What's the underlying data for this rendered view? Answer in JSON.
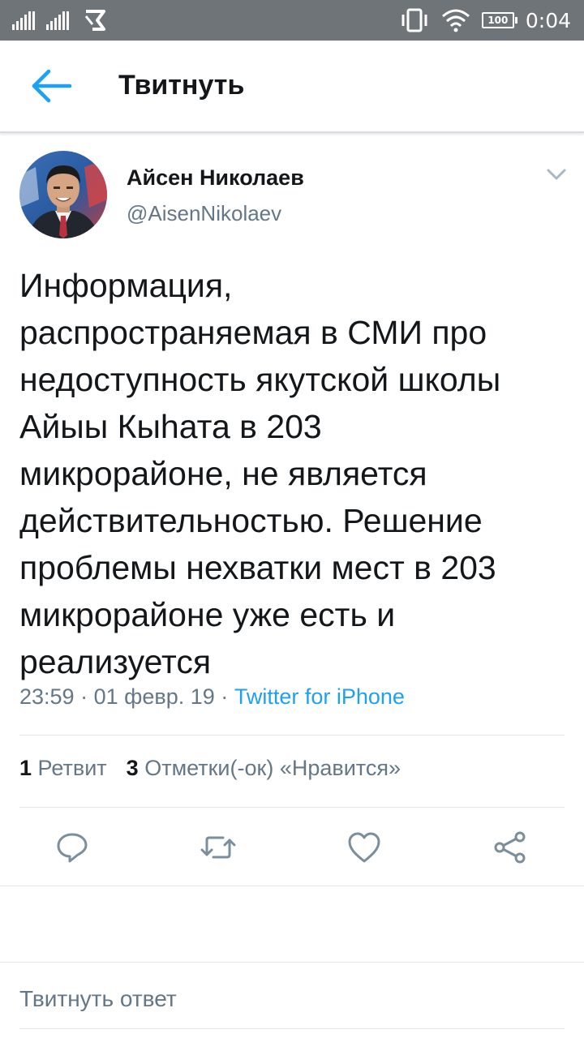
{
  "status_bar": {
    "time": "0:04",
    "battery": "100",
    "icons": [
      "signal-icon",
      "signal-icon",
      "data-saver-icon",
      "vibrate-icon",
      "wifi-icon",
      "battery-icon"
    ]
  },
  "header": {
    "title": "Твитнуть",
    "back_icon": "arrow-left-icon"
  },
  "tweet": {
    "author_name": "Айсен Николаев",
    "author_handle": "@AisenNikolaev",
    "text_lines": [
      "Информация,",
      "распространяемая в СМИ про",
      "недоступность якутской школы",
      "Айыы Кыhата в 203",
      "микрорайоне, не является",
      "действительностью. Решение",
      "проблемы нехватки мест в 203",
      "микрорайоне уже есть и",
      "реализуется"
    ],
    "time": "23:59",
    "date": "01 февр. 19",
    "separator": "·",
    "source": "Twitter for iPhone",
    "retweets_count": "1",
    "retweets_label": "Ретвит",
    "likes_count": "3",
    "likes_label": "Отметки(-ок) «Нравится»"
  },
  "actions": [
    "reply-icon",
    "retweet-icon",
    "like-icon",
    "share-icon"
  ],
  "reply_placeholder": "Твитнуть ответ",
  "colors": {
    "status_bar": "#6f7479",
    "accent": "#1da1f2",
    "text": "#14171a",
    "secondary_text": "#657786",
    "divider": "#e1e8ed"
  }
}
